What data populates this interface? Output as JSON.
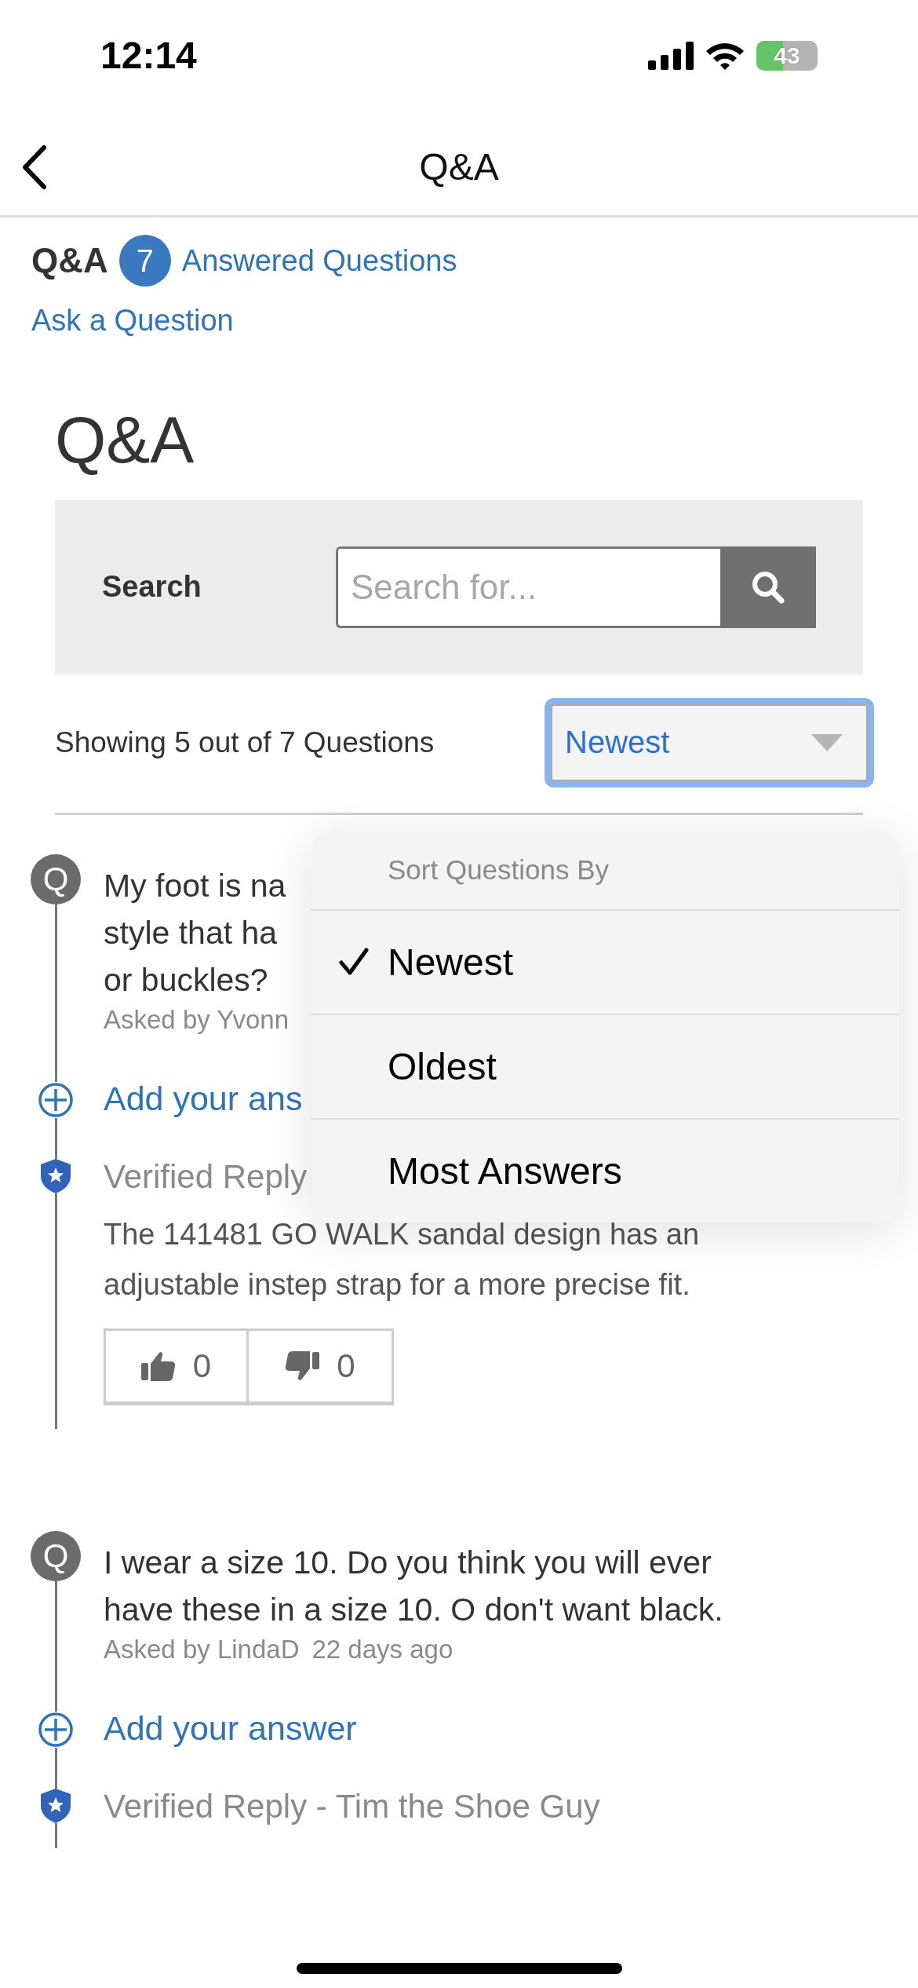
{
  "status_bar": {
    "time": "12:14",
    "battery": "43"
  },
  "nav": {
    "title": "Q&A"
  },
  "summary": {
    "title": "Q&A",
    "count": "7",
    "answered_link": "Answered Questions",
    "ask_link": "Ask a Question"
  },
  "heading": "Q&A",
  "search": {
    "label": "Search",
    "placeholder": "Search for..."
  },
  "results": {
    "text": "Showing 5 out of 7 Questions",
    "sort_value": "Newest"
  },
  "questions": [
    {
      "avatar": "Q",
      "lines": [
        "My foot is na",
        "style that ha",
        "or buckles?"
      ],
      "meta": [
        "Asked by Yvonn"
      ],
      "add_answer": "Add your ans",
      "reply": {
        "header": "Verified Reply",
        "body": "The 141481 GO WALK sandal design has an adjustable instep strap for a more precise fit.",
        "votes": {
          "up": "0",
          "down": "0"
        }
      }
    },
    {
      "avatar": "Q",
      "lines": [
        "I wear a size 10. Do you think you will ever",
        "have these in a size 10. O don't want black."
      ],
      "meta": [
        "Asked by LindaD",
        "22 days ago"
      ],
      "add_answer": "Add your answer",
      "reply": {
        "header": "Verified Reply - Tim the Shoe Guy"
      }
    }
  ],
  "sort_menu": {
    "title": "Sort Questions By",
    "options": [
      {
        "label": "Newest",
        "selected": true
      },
      {
        "label": "Oldest",
        "selected": false
      },
      {
        "label": "Most Answers",
        "selected": false
      }
    ]
  }
}
